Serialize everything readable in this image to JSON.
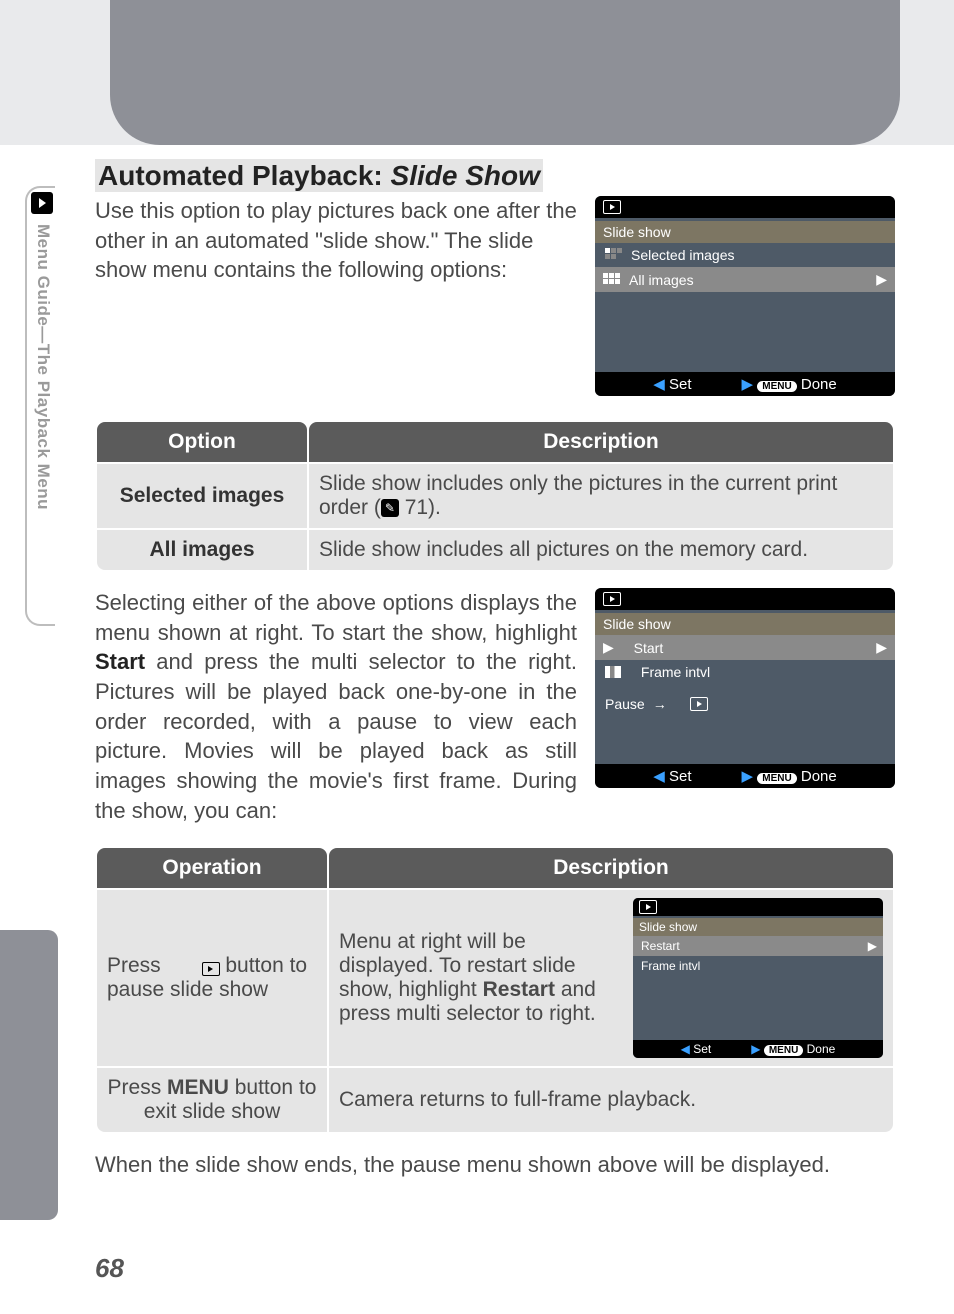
{
  "side_tab_label": "Menu Guide—The Playback Menu",
  "heading_prefix": "Automated Playback: ",
  "heading_em": "Slide Show",
  "intro": "Use this option to play pictures back one after the other in an automated \"slide show.\"  The slide show menu contains the following options:",
  "screen1": {
    "title": "Slide show",
    "row1": "Selected images",
    "row2": "All images",
    "set": "Set",
    "done": "Done"
  },
  "table1": {
    "h1": "Option",
    "h2": "Description",
    "r1c1": "Selected images",
    "r1c2a": "Slide show includes only the pictures in the current print order (",
    "r1c2b": " 71).",
    "r2c1": "All images",
    "r2c2": "Slide show includes all pictures on the memory card."
  },
  "para2a": "Selecting either of the above options displays the menu shown at right.  To start the show, highlight ",
  "para2b": "Start",
  "para2c": " and press the multi selector to the right.  Pictures will be played back one-by-one in the order recorded, with a pause to view each picture.  Movies will be played back as still images showing the movie's first frame.  During the show, you can:",
  "screen2": {
    "title": "Slide show",
    "row1": "Start",
    "row2": "Frame intvl",
    "pause": "Pause",
    "set": "Set",
    "done": "Done"
  },
  "table2": {
    "h1": "Operation",
    "h2": "Description",
    "r1c1a": "Press ",
    "r1c1b": " button to pause slide show",
    "r1c2a": "Menu at right will be displayed.  To restart slide show, highlight ",
    "r1c2b": "Restart",
    "r1c2c": " and press multi selector to right.",
    "r2c1a": "Press ",
    "r2c1b": "MENU",
    "r2c1c": " button to exit slide show",
    "r2c2": "Camera returns to full-frame playback."
  },
  "mini": {
    "title": "Slide show",
    "row1": "Restart",
    "row2": "Frame intvl",
    "set": "Set",
    "done": "Done"
  },
  "footer": "When the slide show ends, the pause menu shown above will be displayed.",
  "page_num": "68"
}
